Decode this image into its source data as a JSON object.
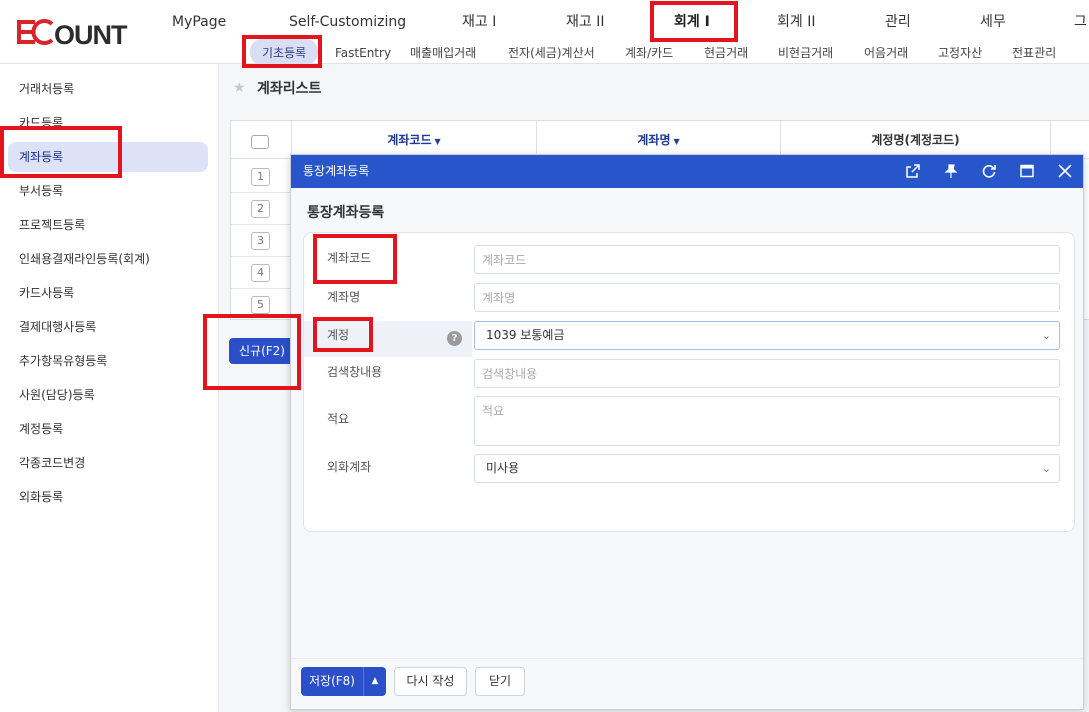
{
  "brand": {
    "logo_text": "ECOUNT",
    "logo_color": "#d6262b"
  },
  "main_nav": [
    {
      "label": "MyPage"
    },
    {
      "label": "Self-Customizing"
    },
    {
      "label": "재고 I"
    },
    {
      "label": "재고 II"
    },
    {
      "label": "회계 I",
      "active": true
    },
    {
      "label": "회계 II"
    },
    {
      "label": "관리"
    },
    {
      "label": "세무"
    },
    {
      "label": "그"
    }
  ],
  "sub_nav": [
    {
      "label": "기초등록",
      "active": true
    },
    {
      "label": "FastEntry"
    },
    {
      "label": "매출매입거래"
    },
    {
      "label": "전자(세금)계산서"
    },
    {
      "label": "계좌/카드"
    },
    {
      "label": "현금거래"
    },
    {
      "label": "비현금거래"
    },
    {
      "label": "어음거래"
    },
    {
      "label": "고정자산"
    },
    {
      "label": "전표관리"
    }
  ],
  "sidebar": {
    "items": [
      {
        "label": "거래처등록"
      },
      {
        "label": "카드등록"
      },
      {
        "label": "계좌등록",
        "active": true
      },
      {
        "label": "부서등록"
      },
      {
        "label": "프로젝트등록"
      },
      {
        "label": "인쇄용결재라인등록(회계)"
      },
      {
        "label": "카드사등록"
      },
      {
        "label": "결제대행사등록"
      },
      {
        "label": "추가항목유형등록"
      },
      {
        "label": "사원(담당)등록"
      },
      {
        "label": "계정등록"
      },
      {
        "label": "각종코드변경"
      },
      {
        "label": "외화등록"
      }
    ]
  },
  "list": {
    "title": "계좌리스트",
    "columns": {
      "code": "계좌코드",
      "name": "계좌명",
      "account": "계정명(계정코드)"
    },
    "row_numbers": [
      "1",
      "2",
      "3",
      "4",
      "5"
    ],
    "new_button": "신규(F2)"
  },
  "modal": {
    "window_title": "통장계좌등록",
    "form_title": "통장계좌등록",
    "icons": [
      "popout-icon",
      "pin-icon",
      "refresh-icon",
      "maximize-icon",
      "close-icon"
    ],
    "fields": {
      "code": {
        "label": "계좌코드",
        "placeholder": "계좌코드"
      },
      "name": {
        "label": "계좌명",
        "placeholder": "계좌명"
      },
      "account": {
        "label": "계정",
        "value": "1039 보통예금"
      },
      "search": {
        "label": "검색창내용",
        "placeholder": "검색창내용"
      },
      "memo": {
        "label": "적요",
        "placeholder": "적요"
      },
      "foreign": {
        "label": "외화계좌",
        "value": "미사용"
      }
    },
    "footer": {
      "save": "저장(F8)",
      "reset": "다시 작성",
      "close": "닫기"
    }
  },
  "colors": {
    "primary": "#2a4fc9",
    "titlebar": "#2656c9",
    "annotation": "#e3141b"
  }
}
